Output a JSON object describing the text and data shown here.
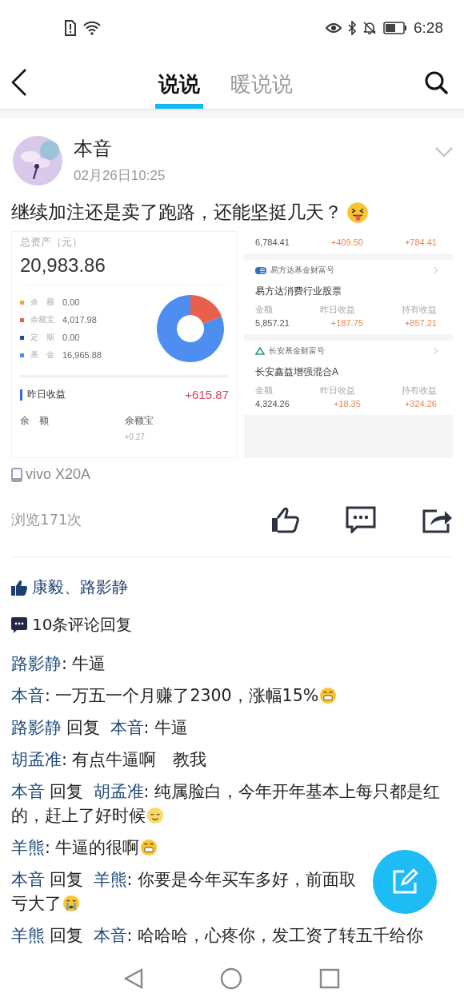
{
  "status_bar": {
    "time": "6:28"
  },
  "tabs": [
    {
      "label": "说说",
      "selected": true
    },
    {
      "label": "暖说说",
      "selected": false
    }
  ],
  "post": {
    "author": "本音",
    "date": "02月26日10:25",
    "text": "继续加注还是卖了跑路，还能坚挺几天？",
    "emoji": {
      "kind": "tongue"
    },
    "left_shot": {
      "assets_label": "总资产（元）",
      "total": "20,983.86",
      "legend": [
        {
          "label": "余　额",
          "amount": "0.00",
          "color": "#f2a93b"
        },
        {
          "label": "余额宝",
          "amount": "4,017.98",
          "color": "#e8604c"
        },
        {
          "label": "定　期",
          "amount": "0.00",
          "color": "#1f4f8f"
        },
        {
          "label": "基　金",
          "amount": "16,965.88",
          "color": "#4e8ef0"
        }
      ],
      "chart_data": {
        "type": "donut",
        "values": [
          0,
          19.15,
          0,
          80.85
        ]
      },
      "yesterday_label": "昨日收益",
      "yesterday_value": "+615.87",
      "sub": [
        {
          "label": "余　额"
        },
        {
          "label": "余额宝",
          "value": "+0.27"
        }
      ]
    },
    "right_shot": {
      "top_row": [
        "6,784.41",
        "+409.50",
        "+784.41"
      ],
      "funds": [
        {
          "provider": "易方达基金财富号",
          "kind": "bars",
          "name": "易方达消费行业股票",
          "labels": [
            "金额",
            "昨日收益",
            "持有收益"
          ],
          "values": [
            "5,857.21",
            "+187.75",
            "+857.21"
          ]
        },
        {
          "provider": "长安基金财富号",
          "kind": "triangle",
          "name": "长安鑫益增强混合A",
          "labels": [
            "金额",
            "昨日收益",
            "持有收益"
          ],
          "values": [
            "4,324.26",
            "+18.35",
            "+324.26"
          ]
        }
      ]
    },
    "device": "vivo X20A",
    "views": "浏览171次"
  },
  "likes": "康毅、路影静",
  "comment_count": "10条评论回复",
  "comments": [
    {
      "author": "路影静",
      "text": ": 牛逼"
    },
    {
      "author": "本音",
      "text": ": 一万五一个月赚了2300，涨幅15%",
      "emoji": {
        "kind": "grin"
      }
    },
    {
      "author": "路影静",
      "reply_word": "回复",
      "reply_to": "本音",
      "text": ": 牛逼"
    },
    {
      "author": "胡孟准",
      "text": ": 有点牛逼啊　教我"
    },
    {
      "author": "本音",
      "reply_word": "回复",
      "reply_to": "胡孟准",
      "text": ": 纯属脸白，今年开年基本上每只都是红的，赶上了好时候",
      "emoji": {
        "kind": "relieved"
      }
    },
    {
      "author": "羊熊",
      "text": ": 牛逼的很啊",
      "emoji": {
        "kind": "grin"
      }
    },
    {
      "author": "本音",
      "reply_word": "回复",
      "reply_to": "羊熊",
      "text": ": 你要是今年买车多好，前面取",
      "text_after": "亏大了",
      "emoji": {
        "kind": "crying"
      }
    },
    {
      "author": "羊熊",
      "reply_word": "回复",
      "reply_to": "本音",
      "text": ": 哈哈哈，心疼你，发工资了转五千给你"
    }
  ]
}
